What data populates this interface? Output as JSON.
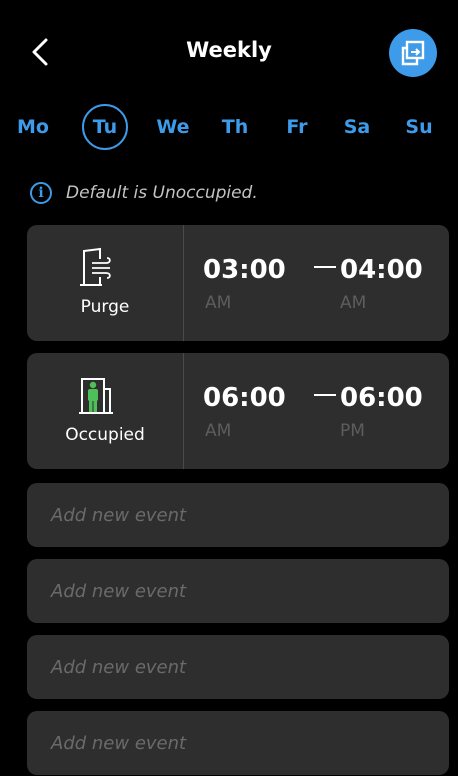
{
  "header": {
    "title": "Weekly"
  },
  "days": [
    "Mo",
    "Tu",
    "We",
    "Th",
    "Fr",
    "Sa",
    "Su"
  ],
  "selected_day": "Tu",
  "info": {
    "icon": "i",
    "text": "Default is Unoccupied."
  },
  "events": [
    {
      "type": "Purge",
      "icon": "purge-icon",
      "start_time": "03:00",
      "start_period": "AM",
      "end_time": "04:00",
      "end_period": "AM"
    },
    {
      "type": "Occupied",
      "icon": "occupied-icon",
      "icon_color": "#4fbf5a",
      "start_time": "06:00",
      "start_period": "AM",
      "end_time": "06:00",
      "end_period": "PM"
    }
  ],
  "add_event_label": "Add new event",
  "colors": {
    "accent": "#3d9be9",
    "card": "#2e2e2e",
    "background": "#000000"
  }
}
